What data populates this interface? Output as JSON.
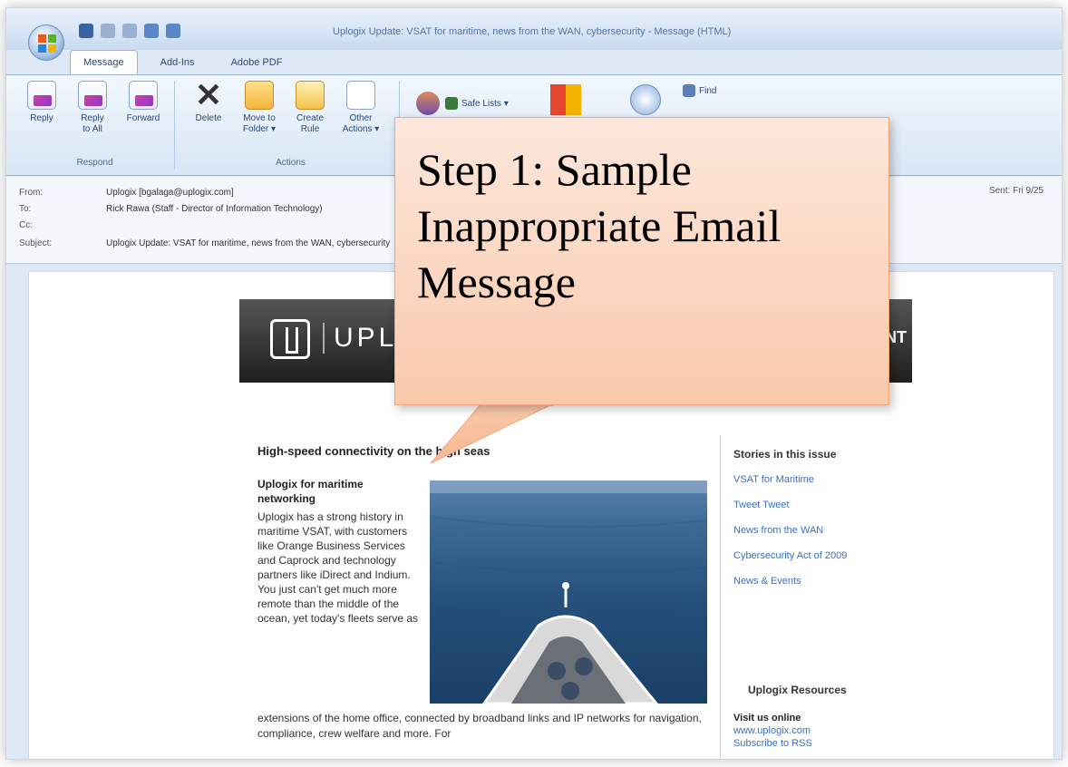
{
  "window": {
    "title": "Uplogix Update: VSAT for maritime, news from the WAN, cybersecurity - Message (HTML)"
  },
  "tabs": [
    {
      "label": "Message",
      "active": true
    },
    {
      "label": "Add-Ins",
      "active": false
    },
    {
      "label": "Adobe PDF",
      "active": false
    }
  ],
  "ribbon": {
    "respond": {
      "label": "Respond",
      "reply": "Reply",
      "reply_all": "Reply\nto All",
      "forward": "Forward"
    },
    "actions": {
      "label": "Actions",
      "delete": "Delete",
      "move_to_folder": "Move to\nFolder ▾",
      "create_rule": "Create\nRule",
      "other_actions": "Other\nActions ▾"
    },
    "junk": {
      "safe_lists": "Safe Lists ▾"
    },
    "find": {
      "find": "Find"
    }
  },
  "headers": {
    "from_label": "From:",
    "from_value": "Uplogix [bgalaga@uplogix.com]",
    "to_label": "To:",
    "to_value": "Rick Rawa (Staff - Director of Information Technology)",
    "cc_label": "Cc:",
    "subject_label": "Subject:",
    "subject_value": "Uplogix Update: VSAT for maritime, news from the WAN, cybersecurity",
    "sent_label": "Sent:",
    "sent_value": "Fri 9/25"
  },
  "newsletter": {
    "banner_text": "UPLOGIX",
    "banner_right": "NT",
    "headline": "High-speed connectivity on the high seas",
    "article_title": "Uplogix for maritime networking",
    "article_body": "Uplogix has a strong history in maritime VSAT, with customers like Orange Business Services and Caprock and technology partners like iDirect and Indium. You just can't get much more remote than the middle of the ocean, yet today's fleets serve as",
    "article_tail": "extensions of the home office, connected by broadband links and IP networks for navigation, compliance, crew welfare and more. For",
    "sidebar_title": "Stories in this issue",
    "sidebar_links": [
      "VSAT for Maritime",
      "Tweet Tweet",
      "News from the WAN",
      "Cybersecurity Act of 2009",
      "News & Events"
    ],
    "resources_title": "Uplogix Resources",
    "visit_title": "Visit us online",
    "visit_url": "www.uplogix.com",
    "rss": "Subscribe to RSS"
  },
  "callout": {
    "text": "Step 1: Sample Inappropriate Email Message"
  },
  "colors": {
    "callout_fill": "#f9c9ab",
    "callout_border": "#f0a679",
    "link": "#3a6fc4",
    "ribbon": "#d7e5f6"
  }
}
